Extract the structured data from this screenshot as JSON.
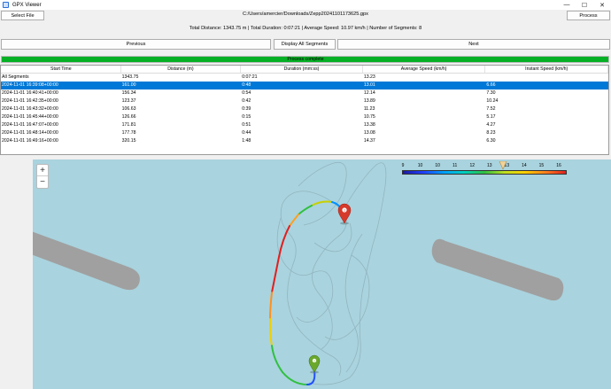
{
  "window": {
    "title": "GPX Viewer",
    "minimize": "—",
    "maximize": "☐",
    "close": "✕"
  },
  "toolbar": {
    "select_file": "Select File",
    "file_path": "C:/Users/amercier/Downloads/Zepp20241101173625.gpx",
    "process": "Process"
  },
  "summary": "Total Distance: 1343.75 m | Total Duration: 0:07:21 | Average Speed: 10.97 km/h | Number of Segments: 8",
  "nav": {
    "previous": "Previous",
    "display_all": "Display All Segments",
    "next": "Next"
  },
  "progress": {
    "value": 1.0,
    "text": "Process complete",
    "color": "#06b025"
  },
  "table": {
    "columns": [
      "Start Time",
      "Distance (m)",
      "Duration (mm:ss)",
      "Average Speed (km/h)",
      "Instant Speed (km/h)"
    ],
    "selected_index": 1,
    "rows": [
      [
        "All Segments",
        "1343.75",
        "0:07:21",
        "13.23",
        ""
      ],
      [
        "2024-11-01 16:39:08+00:00",
        "161.00",
        "0:48",
        "13.01",
        "6.66"
      ],
      [
        "2024-11-01 16:40:41+00:00",
        "156.34",
        "0:54",
        "12.14",
        "7.30"
      ],
      [
        "2024-11-01 16:42:35+00:00",
        "123.37",
        "0:42",
        "13.89",
        "10.24"
      ],
      [
        "2024-11-01 16:43:32+00:00",
        "106.63",
        "0:39",
        "11.23",
        "7.52"
      ],
      [
        "2024-11-01 16:45:44+00:00",
        "126.66",
        "0:15",
        "10.75",
        "5.17"
      ],
      [
        "2024-11-01 16:47:07+00:00",
        "171.81",
        "0:51",
        "13.38",
        "4.27"
      ],
      [
        "2024-11-01 16:48:14+00:00",
        "177.78",
        "0:44",
        "13.08",
        "8.23"
      ],
      [
        "2024-11-01 16:49:16+00:00",
        "320.15",
        "1:48",
        "14.37",
        "6.30"
      ]
    ]
  },
  "map": {
    "zoom_in": "+",
    "zoom_out": "−",
    "water_color": "#a9d3de",
    "legend_ticks": [
      "9",
      "10",
      "10",
      "11",
      "12",
      "13",
      "13",
      "14",
      "15",
      "16"
    ],
    "start_marker_color": "#6aa82c",
    "end_marker_color": "#d63a2a"
  }
}
